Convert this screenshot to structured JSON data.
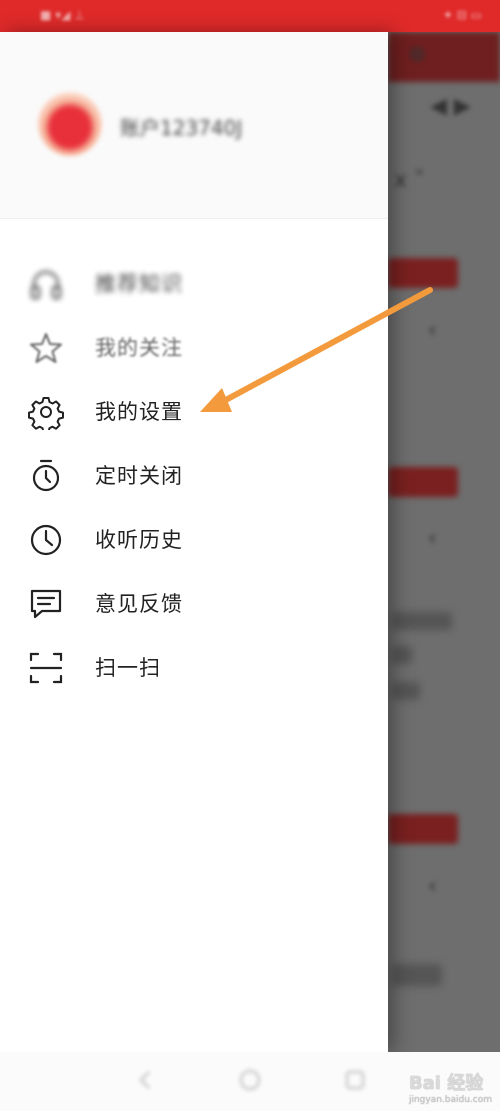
{
  "status_bar": {
    "left_text": "■ ▾◢ ⊥",
    "right_text": "✦ ⊟ ▭"
  },
  "drawer": {
    "username": "账户123740J",
    "menu": [
      {
        "id": "recommend",
        "label": "推荐知识",
        "icon": "headphones-icon"
      },
      {
        "id": "follow",
        "label": "我的关注",
        "icon": "star-icon"
      },
      {
        "id": "settings",
        "label": "我的设置",
        "icon": "gear-icon"
      },
      {
        "id": "timer",
        "label": "定时关闭",
        "icon": "stopwatch-icon"
      },
      {
        "id": "history",
        "label": "收听历史",
        "icon": "clock-icon"
      },
      {
        "id": "feedback",
        "label": "意见反馈",
        "icon": "message-icon"
      },
      {
        "id": "scan",
        "label": "扫一扫",
        "icon": "scan-icon"
      }
    ]
  },
  "annotation": {
    "color": "#f39a3c"
  },
  "colors": {
    "status_bar": "#e02a2a",
    "overlay": "#6e6e6e"
  },
  "watermark": {
    "text": "Bai 经验",
    "sub": "jingyan.baidu.com"
  }
}
